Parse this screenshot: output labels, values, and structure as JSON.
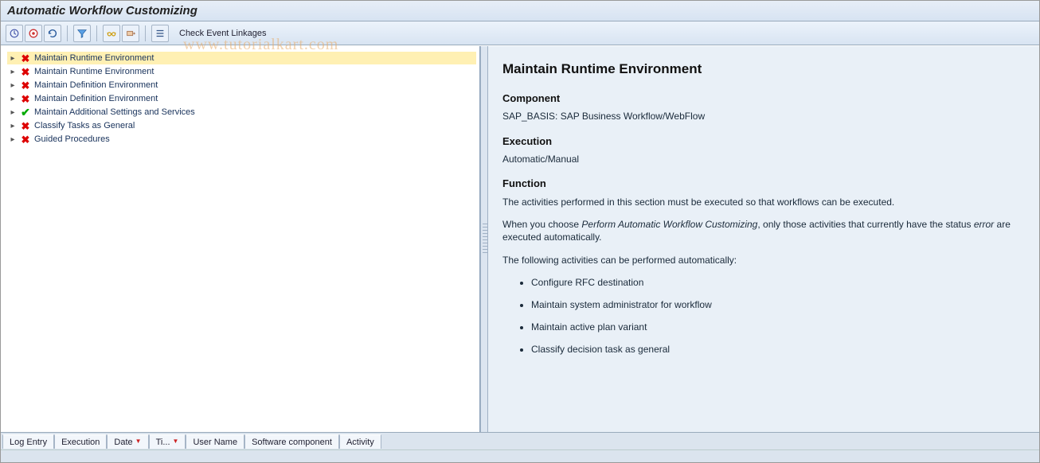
{
  "header": {
    "title": "Automatic Workflow Customizing"
  },
  "toolbar": {
    "check_event_linkages": "Check Event Linkages"
  },
  "watermark": "www.tutorialkart.com",
  "tree": {
    "items": [
      {
        "label": "Maintain Runtime Environment",
        "status": "error",
        "selected": true
      },
      {
        "label": "Maintain Runtime Environment",
        "status": "error",
        "selected": false
      },
      {
        "label": "Maintain Definition Environment",
        "status": "error",
        "selected": false
      },
      {
        "label": "Maintain Definition Environment",
        "status": "error",
        "selected": false
      },
      {
        "label": "Maintain Additional Settings and Services",
        "status": "ok",
        "selected": false
      },
      {
        "label": "Classify Tasks as General",
        "status": "error",
        "selected": false
      },
      {
        "label": "Guided Procedures",
        "status": "error",
        "selected": false
      }
    ]
  },
  "detail": {
    "title": "Maintain Runtime Environment",
    "component_heading": "Component",
    "component_text": "SAP_BASIS: SAP Business Workflow/WebFlow",
    "execution_heading": "Execution",
    "execution_text": "Automatic/Manual",
    "function_heading": "Function",
    "function_p1": "The activities performed in this section must be executed so that workflows can be executed.",
    "function_p2_a": "When you choose ",
    "function_p2_em": "Perform Automatic Workflow Customizing",
    "function_p2_b": ",  only those activities that currently have the status ",
    "function_p2_em2": "error",
    "function_p2_c": " are executed automatically.",
    "function_p3": "The following activities can be performed automatically:",
    "activities": [
      "Configure RFC destination",
      "Maintain system administrator for workflow",
      "Maintain active plan variant",
      "Classify decision task as general"
    ]
  },
  "bottom_tabs": {
    "log_entry": "Log Entry",
    "execution": "Execution",
    "date": "Date",
    "time": "Ti...",
    "user_name": "User Name",
    "software_component": "Software component",
    "activity": "Activity"
  }
}
